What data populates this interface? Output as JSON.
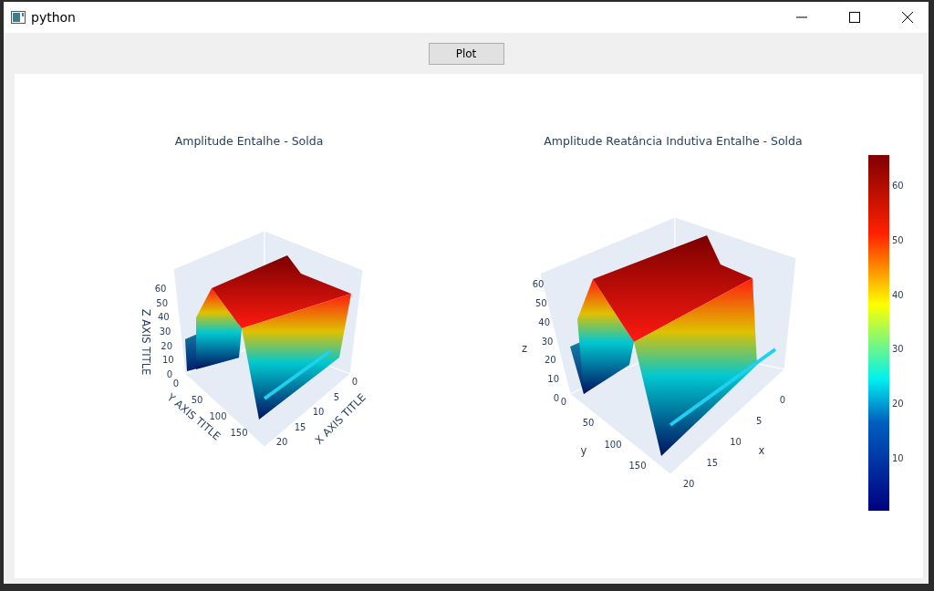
{
  "window": {
    "title": "python"
  },
  "toolbar": {
    "button": "Plot"
  },
  "plots": [
    {
      "title": "Amplitude Entalhe - Solda",
      "x_axis": {
        "title": "X AXIS TITLE",
        "ticks": [
          "0",
          "5",
          "10",
          "15",
          "20"
        ]
      },
      "y_axis": {
        "title": "Y AXIS TITLE",
        "ticks": [
          "0",
          "50",
          "100",
          "150"
        ]
      },
      "z_axis": {
        "title": "Z AXIS TITLE",
        "ticks": [
          "60",
          "50",
          "40",
          "30",
          "20",
          "10",
          "0"
        ]
      }
    },
    {
      "title": "Amplitude Reatância Indutiva Entalhe - Solda",
      "x_axis": {
        "title": "x",
        "ticks": [
          "0",
          "5",
          "10",
          "15",
          "20"
        ]
      },
      "y_axis": {
        "title": "y",
        "ticks": [
          "0",
          "50",
          "100",
          "150"
        ]
      },
      "z_axis": {
        "title": "z",
        "ticks": [
          "60",
          "50",
          "40",
          "30",
          "20",
          "10",
          "0"
        ]
      }
    }
  ],
  "colorbar": {
    "ticks": [
      "60",
      "50",
      "40",
      "30",
      "20",
      "10"
    ]
  }
}
